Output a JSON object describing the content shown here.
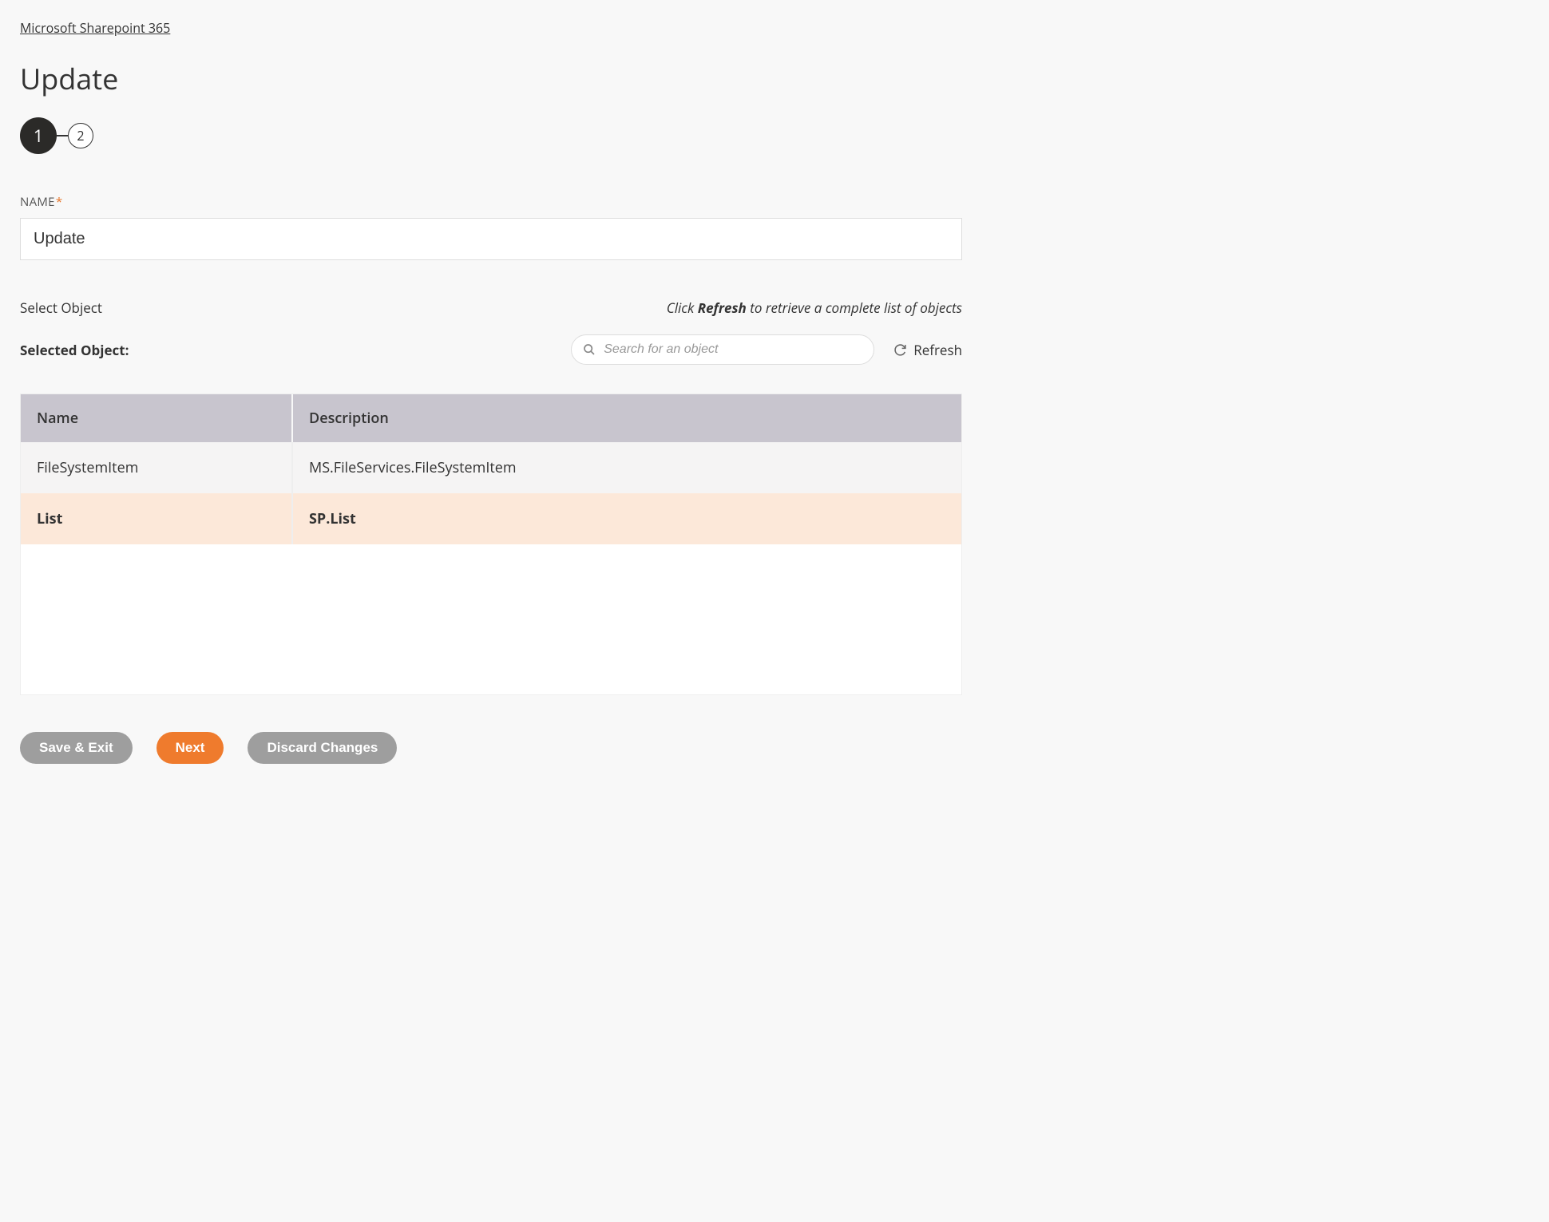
{
  "breadcrumb": "Microsoft Sharepoint 365",
  "title": "Update",
  "stepper": {
    "current": "1",
    "next": "2"
  },
  "nameField": {
    "label": "NAME",
    "value": "Update"
  },
  "selectObject": {
    "heading": "Select Object",
    "hintPrefix": "Click ",
    "hintBold": "Refresh",
    "hintSuffix": " to retrieve a complete list of objects",
    "selectedLabel": "Selected Object:",
    "searchPlaceholder": "Search for an object",
    "refreshLabel": "Refresh"
  },
  "table": {
    "headers": {
      "name": "Name",
      "description": "Description"
    },
    "rows": [
      {
        "name": "FileSystemItem",
        "description": "MS.FileServices.FileSystemItem",
        "selected": false
      },
      {
        "name": "List",
        "description": "SP.List",
        "selected": true
      }
    ]
  },
  "buttons": {
    "saveExit": "Save & Exit",
    "next": "Next",
    "discard": "Discard Changes"
  }
}
